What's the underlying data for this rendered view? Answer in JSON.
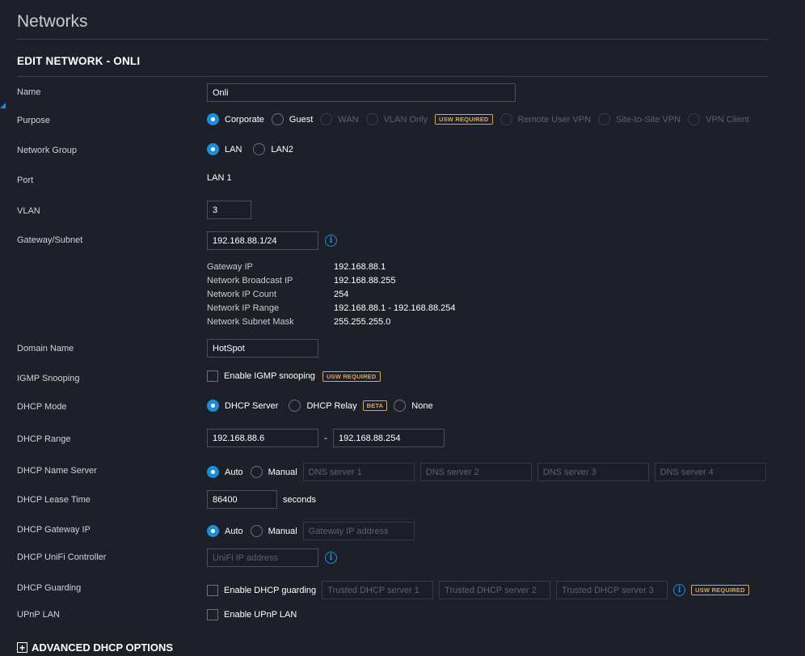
{
  "page": {
    "title": "Networks"
  },
  "section": {
    "title": "EDIT NETWORK - ONLI"
  },
  "name": {
    "label": "Name",
    "value": "Onli"
  },
  "purpose": {
    "label": "Purpose",
    "options": {
      "corporate": "Corporate",
      "guest": "Guest",
      "wan": "WAN",
      "vlan_only": "VLAN Only",
      "remote_user_vpn": "Remote User VPN",
      "site_to_site_vpn": "Site-to-Site VPN",
      "vpn_client": "VPN Client"
    },
    "selected": "Corporate",
    "vlan_only_badge": "USW REQUIRED"
  },
  "network_group": {
    "label": "Network Group",
    "options": {
      "lan": "LAN",
      "lan2": "LAN2"
    },
    "selected": "LAN"
  },
  "port": {
    "label": "Port",
    "value": "LAN 1"
  },
  "vlan": {
    "label": "VLAN",
    "value": "3"
  },
  "gateway_subnet": {
    "label": "Gateway/Subnet",
    "value": "192.168.88.1/24",
    "info_icon": "info-icon",
    "details": {
      "gateway_ip_label": "Gateway IP",
      "gateway_ip": "192.168.88.1",
      "broadcast_label": "Network Broadcast IP",
      "broadcast": "192.168.88.255",
      "count_label": "Network IP Count",
      "count": "254",
      "range_label": "Network IP Range",
      "range": "192.168.88.1 - 192.168.88.254",
      "mask_label": "Network Subnet Mask",
      "mask": "255.255.255.0"
    }
  },
  "domain_name": {
    "label": "Domain Name",
    "value": "HotSpot"
  },
  "igmp": {
    "label": "IGMP Snooping",
    "checkbox_label": "Enable IGMP snooping",
    "checked": false,
    "badge": "USW REQUIRED"
  },
  "dhcp_mode": {
    "label": "DHCP Mode",
    "options": {
      "server": "DHCP Server",
      "relay": "DHCP Relay",
      "none": "None"
    },
    "selected": "DHCP Server",
    "relay_badge": "BETA"
  },
  "dhcp_range": {
    "label": "DHCP Range",
    "start": "192.168.88.6",
    "separator": "-",
    "end": "192.168.88.254"
  },
  "dhcp_name_server": {
    "label": "DHCP Name Server",
    "options": {
      "auto": "Auto",
      "manual": "Manual"
    },
    "selected": "Auto",
    "placeholders": {
      "dns1": "DNS server 1",
      "dns2": "DNS server 2",
      "dns3": "DNS server 3",
      "dns4": "DNS server 4"
    }
  },
  "dhcp_lease_time": {
    "label": "DHCP Lease Time",
    "value": "86400",
    "unit": "seconds"
  },
  "dhcp_gateway_ip": {
    "label": "DHCP Gateway IP",
    "options": {
      "auto": "Auto",
      "manual": "Manual"
    },
    "selected": "Auto",
    "placeholder": "Gateway IP address"
  },
  "dhcp_unifi_controller": {
    "label": "DHCP UniFi Controller",
    "placeholder": "UniFi IP address",
    "info_icon": "info-icon"
  },
  "dhcp_guarding": {
    "label": "DHCP Guarding",
    "checkbox_label": "Enable DHCP guarding",
    "checked": false,
    "placeholders": {
      "s1": "Trusted DHCP server 1",
      "s2": "Trusted DHCP server 2",
      "s3": "Trusted DHCP server 3"
    },
    "badge": "USW REQUIRED"
  },
  "upnp": {
    "label": "UPnP LAN",
    "checkbox_label": "Enable UPnP LAN",
    "checked": false
  },
  "advanced": {
    "label": "ADVANCED DHCP OPTIONS",
    "icon": "plus-square-icon"
  },
  "colors": {
    "accent": "#1a8fd8",
    "badge": "#f0a52a",
    "background": "#1d2028"
  }
}
